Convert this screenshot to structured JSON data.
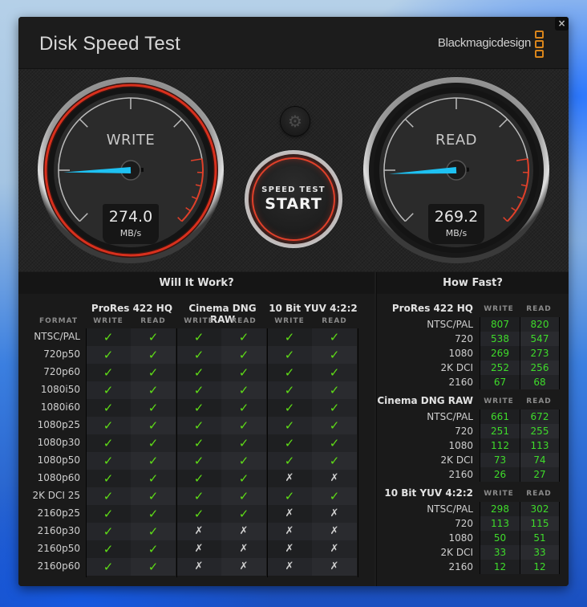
{
  "window": {
    "title": "Disk Speed Test",
    "brand": "Blackmagicdesign",
    "close_label": "×"
  },
  "gauges": {
    "write": {
      "label": "WRITE",
      "value": "274.0",
      "unit": "MB/s",
      "needle_fraction": 0.16
    },
    "read": {
      "label": "READ",
      "value": "269.2",
      "unit": "MB/s",
      "needle_fraction": 0.155
    }
  },
  "controls": {
    "settings_icon": "gear-icon",
    "start_small": "SPEED TEST",
    "start_big": "START"
  },
  "colors": {
    "needle": "#1ec1f2",
    "redzone": "#e0402a",
    "check": "#5fdd17",
    "speed_value": "#3fdc2b",
    "brand_logo": "#d9851b"
  },
  "will_it_work": {
    "title": "Will It Work?",
    "format_header": "FORMAT",
    "codecs": [
      "ProRes 422 HQ",
      "Cinema DNG RAW",
      "10 Bit YUV 4:2:2"
    ],
    "sub_headers": [
      "WRITE",
      "READ",
      "WRITE",
      "READ",
      "WRITE",
      "READ"
    ],
    "rows": [
      {
        "format": "NTSC/PAL",
        "results": [
          "✓",
          "✓",
          "✓",
          "✓",
          "✓",
          "✓"
        ]
      },
      {
        "format": "720p50",
        "results": [
          "✓",
          "✓",
          "✓",
          "✓",
          "✓",
          "✓"
        ]
      },
      {
        "format": "720p60",
        "results": [
          "✓",
          "✓",
          "✓",
          "✓",
          "✓",
          "✓"
        ]
      },
      {
        "format": "1080i50",
        "results": [
          "✓",
          "✓",
          "✓",
          "✓",
          "✓",
          "✓"
        ]
      },
      {
        "format": "1080i60",
        "results": [
          "✓",
          "✓",
          "✓",
          "✓",
          "✓",
          "✓"
        ]
      },
      {
        "format": "1080p25",
        "results": [
          "✓",
          "✓",
          "✓",
          "✓",
          "✓",
          "✓"
        ]
      },
      {
        "format": "1080p30",
        "results": [
          "✓",
          "✓",
          "✓",
          "✓",
          "✓",
          "✓"
        ]
      },
      {
        "format": "1080p50",
        "results": [
          "✓",
          "✓",
          "✓",
          "✓",
          "✓",
          "✓"
        ]
      },
      {
        "format": "1080p60",
        "results": [
          "✓",
          "✓",
          "✓",
          "✓",
          "✗",
          "✗"
        ]
      },
      {
        "format": "2K DCI 25",
        "results": [
          "✓",
          "✓",
          "✓",
          "✓",
          "✓",
          "✓"
        ]
      },
      {
        "format": "2160p25",
        "results": [
          "✓",
          "✓",
          "✓",
          "✓",
          "✗",
          "✗"
        ]
      },
      {
        "format": "2160p30",
        "results": [
          "✓",
          "✓",
          "✗",
          "✗",
          "✗",
          "✗"
        ]
      },
      {
        "format": "2160p50",
        "results": [
          "✓",
          "✓",
          "✗",
          "✗",
          "✗",
          "✗"
        ]
      },
      {
        "format": "2160p60",
        "results": [
          "✓",
          "✓",
          "✗",
          "✗",
          "✗",
          "✗"
        ]
      }
    ]
  },
  "how_fast": {
    "title": "How Fast?",
    "col_write": "WRITE",
    "col_read": "READ",
    "groups": [
      {
        "codec": "ProRes 422 HQ",
        "rows": [
          {
            "format": "NTSC/PAL",
            "write": "807",
            "read": "820"
          },
          {
            "format": "720",
            "write": "538",
            "read": "547"
          },
          {
            "format": "1080",
            "write": "269",
            "read": "273"
          },
          {
            "format": "2K DCI",
            "write": "252",
            "read": "256"
          },
          {
            "format": "2160",
            "write": "67",
            "read": "68"
          }
        ]
      },
      {
        "codec": "Cinema DNG RAW",
        "rows": [
          {
            "format": "NTSC/PAL",
            "write": "661",
            "read": "672"
          },
          {
            "format": "720",
            "write": "251",
            "read": "255"
          },
          {
            "format": "1080",
            "write": "112",
            "read": "113"
          },
          {
            "format": "2K DCI",
            "write": "73",
            "read": "74"
          },
          {
            "format": "2160",
            "write": "26",
            "read": "27"
          }
        ]
      },
      {
        "codec": "10 Bit YUV 4:2:2",
        "rows": [
          {
            "format": "NTSC/PAL",
            "write": "298",
            "read": "302"
          },
          {
            "format": "720",
            "write": "113",
            "read": "115"
          },
          {
            "format": "1080",
            "write": "50",
            "read": "51"
          },
          {
            "format": "2K DCI",
            "write": "33",
            "read": "33"
          },
          {
            "format": "2160",
            "write": "12",
            "read": "12"
          }
        ]
      }
    ]
  }
}
